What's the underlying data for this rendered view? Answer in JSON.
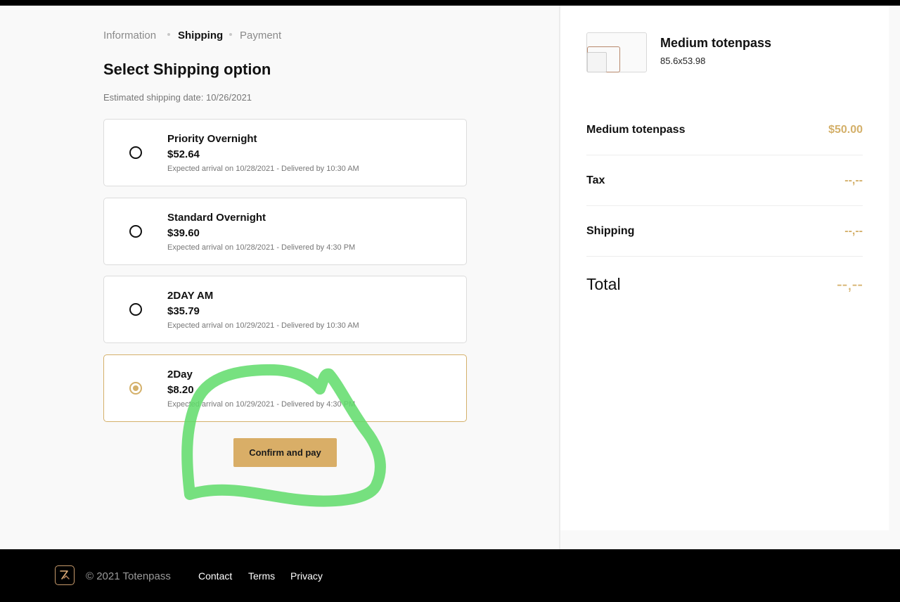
{
  "breadcrumb": {
    "steps": [
      "Information",
      "Shipping",
      "Payment"
    ],
    "active_step": "Shipping"
  },
  "shipping": {
    "title": "Select Shipping option",
    "estimated_date": "Estimated shipping date: 10/26/2021",
    "options": [
      {
        "name": "Priority Overnight",
        "price": "$52.64",
        "detail": "Expected arrival on 10/28/2021 - Delivered by 10:30 AM",
        "selected": false
      },
      {
        "name": "Standard Overnight",
        "price": "$39.60",
        "detail": "Expected arrival on 10/28/2021 - Delivered by 4:30 PM",
        "selected": false
      },
      {
        "name": "2DAY AM",
        "price": "$35.79",
        "detail": "Expected arrival on 10/29/2021 - Delivered by 10:30 AM",
        "selected": false
      },
      {
        "name": "2Day",
        "price": "$8.20",
        "detail": "Expected arrival on 10/29/2021 - Delivered by 4:30 PM",
        "selected": true
      }
    ],
    "confirm_label": "Confirm and pay"
  },
  "order": {
    "product_name": "Medium totenpass",
    "product_size": "85.6x53.98",
    "lines": [
      {
        "label": "Medium totenpass",
        "value": "$50.00"
      },
      {
        "label": "Tax",
        "value": "--,--"
      },
      {
        "label": "Shipping",
        "value": "--,--"
      }
    ],
    "total_label": "Total",
    "total_value": "--,--"
  },
  "footer": {
    "copyright": "© 2021 Totenpass",
    "links": [
      "Contact",
      "Terms",
      "Privacy"
    ]
  },
  "colors": {
    "accent": "#d4b06a",
    "button": "#d9ae67",
    "annotation": "#5fdc6a",
    "footer_bg": "#000000"
  },
  "icons": {
    "footer_logo": "totenpass-logo-icon",
    "product": "card-thumbnail-icon"
  }
}
